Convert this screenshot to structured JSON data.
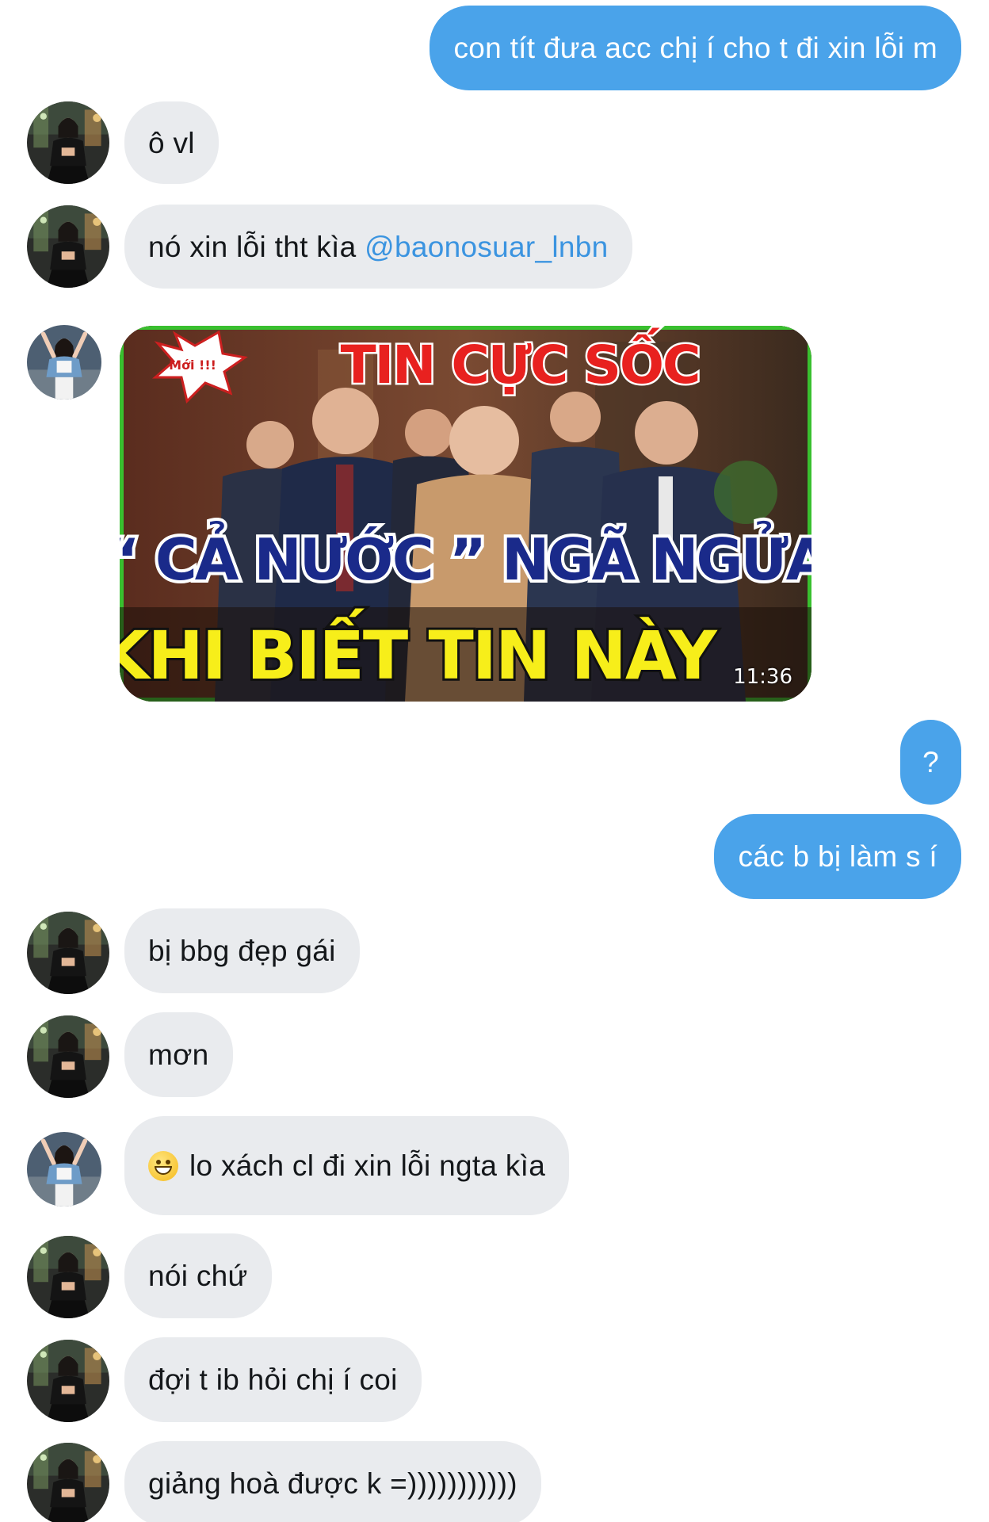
{
  "conversation": {
    "messages": [
      {
        "id": "m1",
        "direction": "out",
        "text": "con tít đưa acc chị í cho t đi xin lỗi m"
      },
      {
        "id": "m2",
        "direction": "in",
        "sender": "user-a",
        "text": "ô vl"
      },
      {
        "id": "m3",
        "direction": "in",
        "sender": "user-a",
        "text": "nó xin lỗi tht kìa ",
        "mention": "@baonosuar_lnbn"
      },
      {
        "id": "m4",
        "direction": "in",
        "sender": "user-b",
        "type": "video",
        "thumbnail": {
          "badge": "Mới !!!",
          "headline": "TIN CỰC SỐC",
          "caption_line1": "“ CẢ NƯỚC ” NGÃ NGỬA",
          "caption_line2": "KHI BIẾT TIN NÀY",
          "duration": "11:36"
        }
      },
      {
        "id": "m5",
        "direction": "out",
        "text": "?"
      },
      {
        "id": "m6",
        "direction": "out",
        "text": "các b bị làm s í"
      },
      {
        "id": "m7",
        "direction": "in",
        "sender": "user-a",
        "text": "bị bbg đẹp gái"
      },
      {
        "id": "m8",
        "direction": "in",
        "sender": "user-a",
        "text": "mơn"
      },
      {
        "id": "m9",
        "direction": "in",
        "sender": "user-b",
        "emoji": "grinning-face",
        "text": "lo xách cl đi xin lỗi ngta kìa"
      },
      {
        "id": "m10",
        "direction": "in",
        "sender": "user-a",
        "text": "nói chứ"
      },
      {
        "id": "m11",
        "direction": "in",
        "sender": "user-a",
        "text": "đợi t ib hỏi chị í coi"
      },
      {
        "id": "m12",
        "direction": "in",
        "sender": "user-a",
        "text": "giảng hoà được k =)))))))))))"
      }
    ]
  },
  "colors": {
    "outgoing_bubble": "#4aa3ea",
    "incoming_bubble": "#e9ebee",
    "mention": "#3b94e0",
    "incoming_text": "#14171a"
  },
  "icons": {
    "user_a_avatar": "avatar-user-a",
    "user_b_avatar": "avatar-user-b",
    "emoji": "grinning-face-emoji"
  }
}
